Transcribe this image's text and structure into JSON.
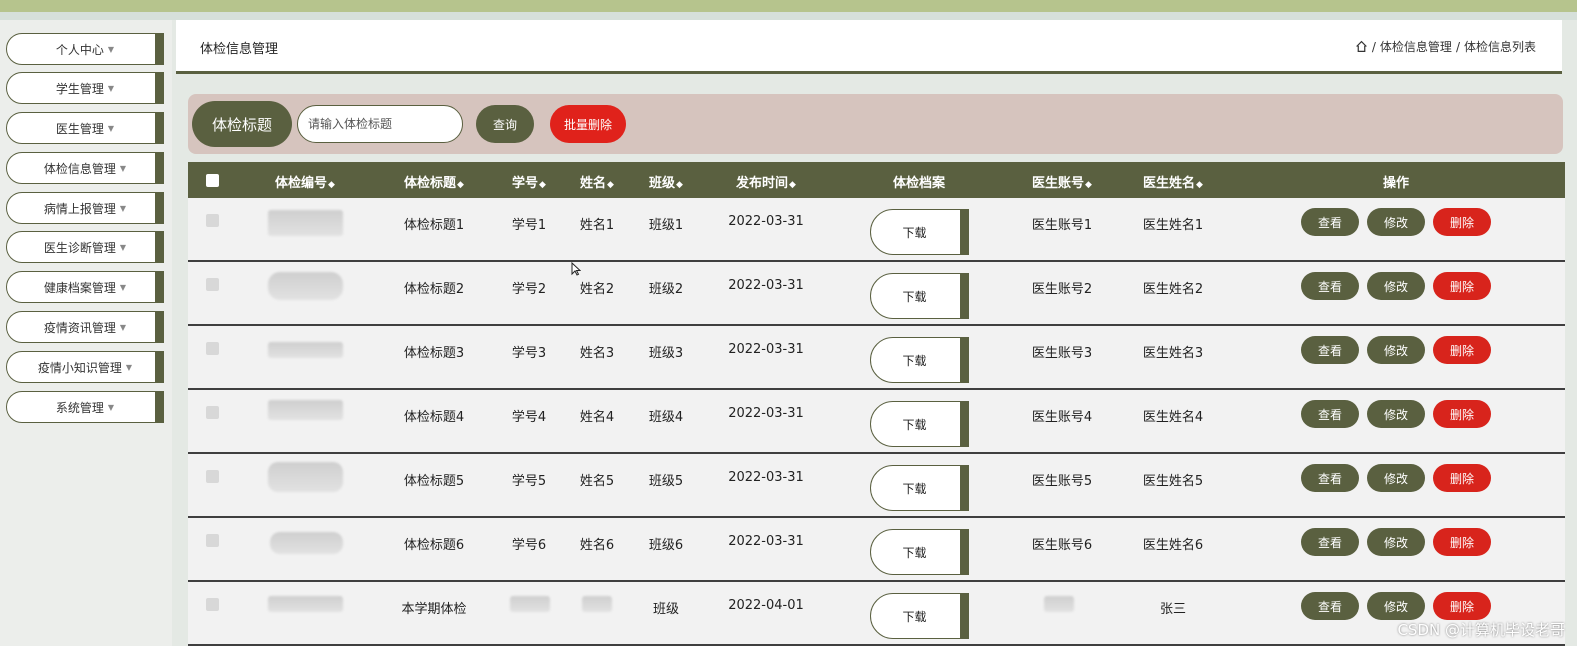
{
  "sidebar": {
    "items": [
      {
        "label": "个人中心"
      },
      {
        "label": "学生管理"
      },
      {
        "label": "医生管理"
      },
      {
        "label": "体检信息管理"
      },
      {
        "label": "病情上报管理"
      },
      {
        "label": "医生诊断管理"
      },
      {
        "label": "健康档案管理"
      },
      {
        "label": "疫情资讯管理"
      },
      {
        "label": "疫情小知识管理"
      },
      {
        "label": "系统管理"
      }
    ]
  },
  "header": {
    "title": "体检信息管理",
    "breadcrumb": {
      "level1": "体检信息管理",
      "level2": "体检信息列表"
    }
  },
  "search": {
    "label": "体检标题",
    "placeholder": "请输入体检标题",
    "query_label": "查询",
    "batch_delete_label": "批量删除"
  },
  "table": {
    "headers": {
      "code": "体检编号",
      "title": "体检标题",
      "student_no": "学号",
      "name": "姓名",
      "class": "班级",
      "publish_time": "发布时间",
      "file": "体检档案",
      "doctor_account": "医生账号",
      "doctor_name": "医生姓名",
      "ops": "操作"
    },
    "download_label": "下载",
    "view_label": "查看",
    "edit_label": "修改",
    "delete_label": "删除",
    "rows": [
      {
        "title": "体检标题1",
        "student_no": "学号1",
        "name": "姓名1",
        "class": "班级1",
        "publish_time": "2022-03-31",
        "doctor_account": "医生账号1",
        "doctor_name": "医生姓名1"
      },
      {
        "title": "体检标题2",
        "student_no": "学号2",
        "name": "姓名2",
        "class": "班级2",
        "publish_time": "2022-03-31",
        "doctor_account": "医生账号2",
        "doctor_name": "医生姓名2"
      },
      {
        "title": "体检标题3",
        "student_no": "学号3",
        "name": "姓名3",
        "class": "班级3",
        "publish_time": "2022-03-31",
        "doctor_account": "医生账号3",
        "doctor_name": "医生姓名3"
      },
      {
        "title": "体检标题4",
        "student_no": "学号4",
        "name": "姓名4",
        "class": "班级4",
        "publish_time": "2022-03-31",
        "doctor_account": "医生账号4",
        "doctor_name": "医生姓名4"
      },
      {
        "title": "体检标题5",
        "student_no": "学号5",
        "name": "姓名5",
        "class": "班级5",
        "publish_time": "2022-03-31",
        "doctor_account": "医生账号5",
        "doctor_name": "医生姓名5"
      },
      {
        "title": "体检标题6",
        "student_no": "学号6",
        "name": "姓名6",
        "class": "班级6",
        "publish_time": "2022-03-31",
        "doctor_account": "医生账号6",
        "doctor_name": "医生姓名6"
      },
      {
        "title": "本学期体检",
        "student_no": "",
        "name": "",
        "class": "班级",
        "publish_time": "2022-04-01",
        "doctor_account": "",
        "doctor_name": "张三"
      }
    ]
  },
  "watermark": "CSDN @计算机毕设老哥",
  "colors": {
    "accent": "#5a6040",
    "danger": "#d8241c",
    "search_bg": "#d6c4be"
  }
}
